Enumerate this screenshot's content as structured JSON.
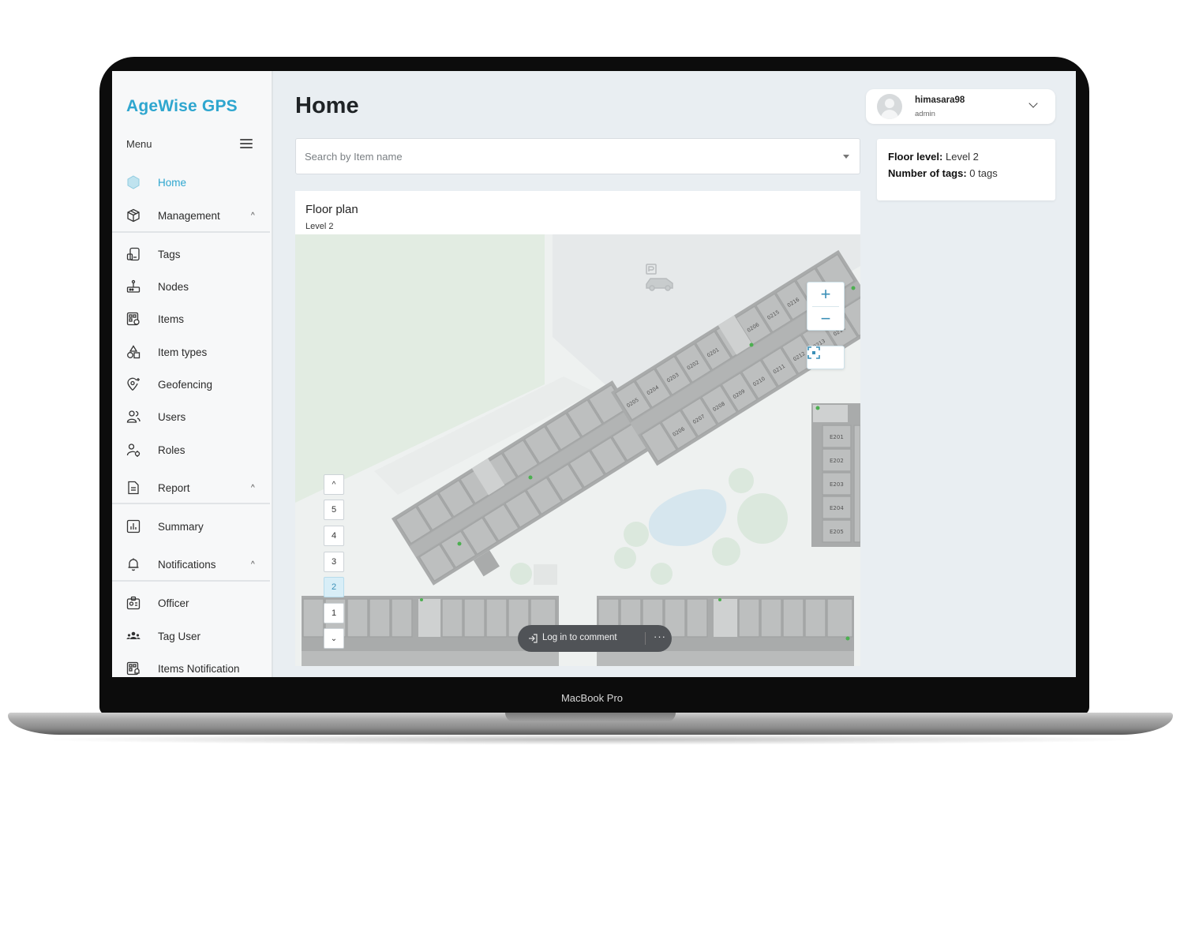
{
  "device": {
    "label": "MacBook Pro"
  },
  "app": {
    "brand": "AgeWise GPS",
    "menu_label": "Menu"
  },
  "sidebar": {
    "items": [
      {
        "label": "Home",
        "icon": "home-icon",
        "active": true
      },
      {
        "label": "Management",
        "icon": "cube-icon",
        "chevron": "^"
      },
      {
        "label": "Tags",
        "icon": "tag-icon"
      },
      {
        "label": "Nodes",
        "icon": "node-icon"
      },
      {
        "label": "Items",
        "icon": "items-icon"
      },
      {
        "label": "Item types",
        "icon": "shapes-icon"
      },
      {
        "label": "Geofencing",
        "icon": "geofence-icon"
      },
      {
        "label": "Users",
        "icon": "users-icon"
      },
      {
        "label": "Roles",
        "icon": "roles-icon"
      },
      {
        "label": "Report",
        "icon": "document-icon",
        "chevron": "^"
      },
      {
        "label": "Summary",
        "icon": "chart-icon"
      },
      {
        "label": "Notifications",
        "icon": "bell-icon",
        "chevron": "^"
      },
      {
        "label": "Officer",
        "icon": "badge-icon"
      },
      {
        "label": "Tag User",
        "icon": "group-icon"
      },
      {
        "label": "Items Notification",
        "icon": "items-notification-icon"
      }
    ]
  },
  "header": {
    "title": "Home"
  },
  "search": {
    "placeholder": "Search by Item name"
  },
  "user": {
    "name": "himasara98",
    "role": "admin"
  },
  "info": {
    "floor_label": "Floor level:",
    "floor_value": "Level 2",
    "tags_label": "Number of tags:",
    "tags_value": "0 tags"
  },
  "floor_plan": {
    "title": "Floor plan",
    "subtitle": "Level 2",
    "zoom_in": "+",
    "zoom_out": "−",
    "floors": [
      "5",
      "4",
      "3",
      "2",
      "1"
    ],
    "active_floor": "2",
    "floor_up": "^",
    "floor_down": "⌄",
    "room_labels_upper": [
      "0205",
      "0204",
      "0203",
      "0202",
      "0201",
      "0206",
      "0215",
      "0216",
      "0217"
    ],
    "room_labels_lower": [
      "0206",
      "0207",
      "0208",
      "0209",
      "0210",
      "0211",
      "0212",
      "0213",
      "0214"
    ],
    "room_labels_right": [
      "E201",
      "E202",
      "E203",
      "E204",
      "E205"
    ]
  },
  "comment": {
    "label": "Log in to comment",
    "more": "···"
  },
  "colors": {
    "accent": "#2ea6cf",
    "building": "#a9abab",
    "room": "#b9bbbb"
  }
}
